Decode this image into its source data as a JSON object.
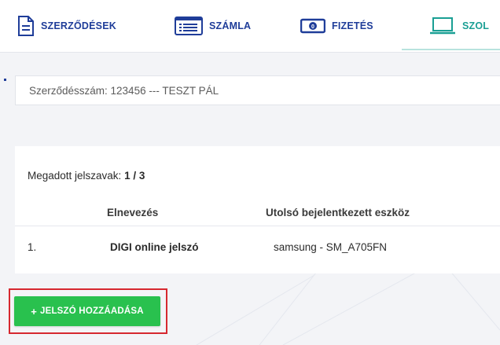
{
  "nav": {
    "items": [
      {
        "label": "SZERZŐDÉSEK",
        "icon": "document-icon"
      },
      {
        "label": "SZÁMLA",
        "icon": "invoice-list-icon"
      },
      {
        "label": "FIZETÉS",
        "icon": "banknote-icon"
      },
      {
        "label": "SZOLGÁLTATÁSOK",
        "icon": "laptop-icon",
        "active": true
      }
    ],
    "visible_labels": [
      "SZERZŐDÉSEK",
      "SZÁMLA",
      "FIZETÉS",
      "SZOL"
    ]
  },
  "contract": {
    "text": "Szerződésszám: 123456 --- TESZT PÁL"
  },
  "passwords": {
    "count_label": "Megadott jelszavak:",
    "count_value": "1 / 3",
    "columns": [
      "Elnevezés",
      "Utolsó bejelentkezett eszköz"
    ],
    "rows": [
      {
        "index": "1.",
        "name": "DIGI online jelszó",
        "device": "samsung - SM_A705FN"
      }
    ]
  },
  "add_button": {
    "plus": "+",
    "label": "JELSZÓ HOZZÁADÁSA"
  },
  "colors": {
    "nav_blue": "#1f3d99",
    "active_teal": "#1a9f94",
    "button_green": "#29c14e",
    "highlight_red": "#d6282f"
  }
}
